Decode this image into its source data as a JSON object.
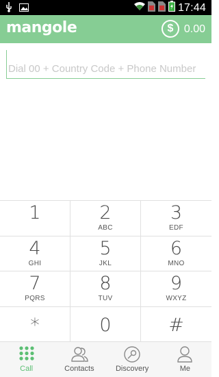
{
  "status_bar": {
    "time": "17:44",
    "icons": [
      "usb-icon",
      "image-icon",
      "wifi-icon",
      "sim-icon",
      "sim-icon",
      "battery-charging-icon"
    ]
  },
  "app_bar": {
    "logo": "mangole",
    "balance_icon": "$",
    "balance": "0.00"
  },
  "dialer": {
    "placeholder": "Dial 00 + Country Code + Phone Number",
    "value": ""
  },
  "keypad": [
    {
      "digit": "1",
      "letters": ""
    },
    {
      "digit": "2",
      "letters": "ABC"
    },
    {
      "digit": "3",
      "letters": "EDF"
    },
    {
      "digit": "4",
      "letters": "GHI"
    },
    {
      "digit": "5",
      "letters": "JKL"
    },
    {
      "digit": "6",
      "letters": "MNO"
    },
    {
      "digit": "7",
      "letters": "PQRS"
    },
    {
      "digit": "8",
      "letters": "TUV"
    },
    {
      "digit": "9",
      "letters": "WXYZ"
    },
    {
      "digit": "*",
      "letters": ""
    },
    {
      "digit": "0",
      "letters": ""
    },
    {
      "digit": "#",
      "letters": ""
    }
  ],
  "tabs": [
    {
      "label": "Call",
      "icon": "dialpad-icon",
      "active": true
    },
    {
      "label": "Contacts",
      "icon": "contacts-icon",
      "active": false
    },
    {
      "label": "Discovery",
      "icon": "compass-icon",
      "active": false
    },
    {
      "label": "Me",
      "icon": "person-icon",
      "active": false
    }
  ],
  "colors": {
    "accent": "#86cd94",
    "active_tab": "#5cbf74",
    "status_bar": "#000000"
  }
}
